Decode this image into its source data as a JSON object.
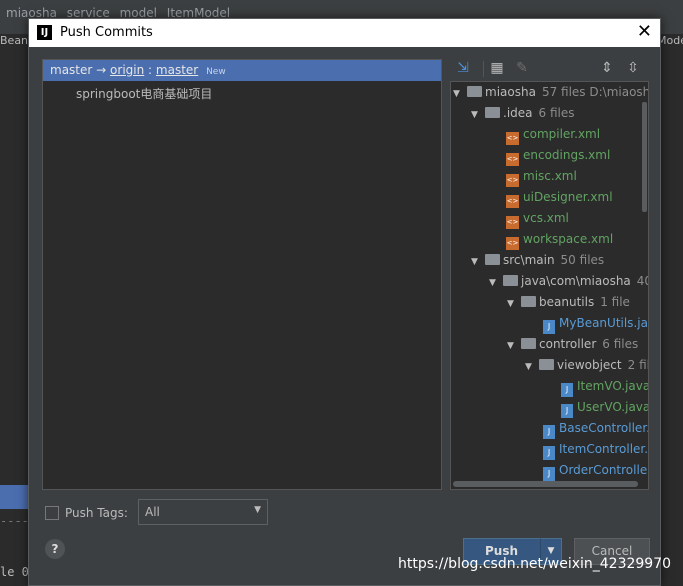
{
  "ide": {
    "breadcrumbs": [
      "miaosha",
      "service",
      "model",
      "ItemModel"
    ],
    "left_tab": "Bean",
    "right_tab": "Mode",
    "bottom_text": "le  0",
    "dashes": "-------"
  },
  "dialog": {
    "title": "Push Commits",
    "commit_row": {
      "local": "master",
      "arrow": "→",
      "remote": "origin",
      "sep": ":",
      "branch": "master",
      "badge": "New"
    },
    "commit_message": "springboot电商基础项目",
    "tree": [
      {
        "name": "miaosha",
        "meta": "57 files  D:\\miaosh",
        "type": "folder"
      },
      {
        "name": ".idea",
        "meta": "6 files",
        "type": "folder"
      },
      {
        "name": "compiler.xml",
        "type": "xml"
      },
      {
        "name": "encodings.xml",
        "type": "xml"
      },
      {
        "name": "misc.xml",
        "type": "xml"
      },
      {
        "name": "uiDesigner.xml",
        "type": "xml"
      },
      {
        "name": "vcs.xml",
        "type": "xml"
      },
      {
        "name": "workspace.xml",
        "type": "xml"
      },
      {
        "name": "src\\main",
        "meta": "50 files",
        "type": "folder"
      },
      {
        "name": "java\\com\\miaosha",
        "meta": "40",
        "type": "folder"
      },
      {
        "name": "beanutils",
        "meta": "1 file",
        "type": "folder"
      },
      {
        "name": "MyBeanUtils.java",
        "type": "java"
      },
      {
        "name": "controller",
        "meta": "6 files",
        "type": "folder"
      },
      {
        "name": "viewobject",
        "meta": "2 fil",
        "type": "folder"
      },
      {
        "name": "ItemVO.java",
        "type": "java"
      },
      {
        "name": "UserVO.java",
        "type": "java"
      },
      {
        "name": "BaseController.",
        "type": "java"
      },
      {
        "name": "ItemController.",
        "type": "java"
      },
      {
        "name": "OrderControlle",
        "type": "java"
      }
    ],
    "push_tags_label": "Push Tags:",
    "tags_select_value": "All",
    "help_label": "?",
    "push_label": "Push",
    "cancel_label": "Cancel"
  },
  "watermark": "https://blog.csdn.net/weixin_42329970"
}
